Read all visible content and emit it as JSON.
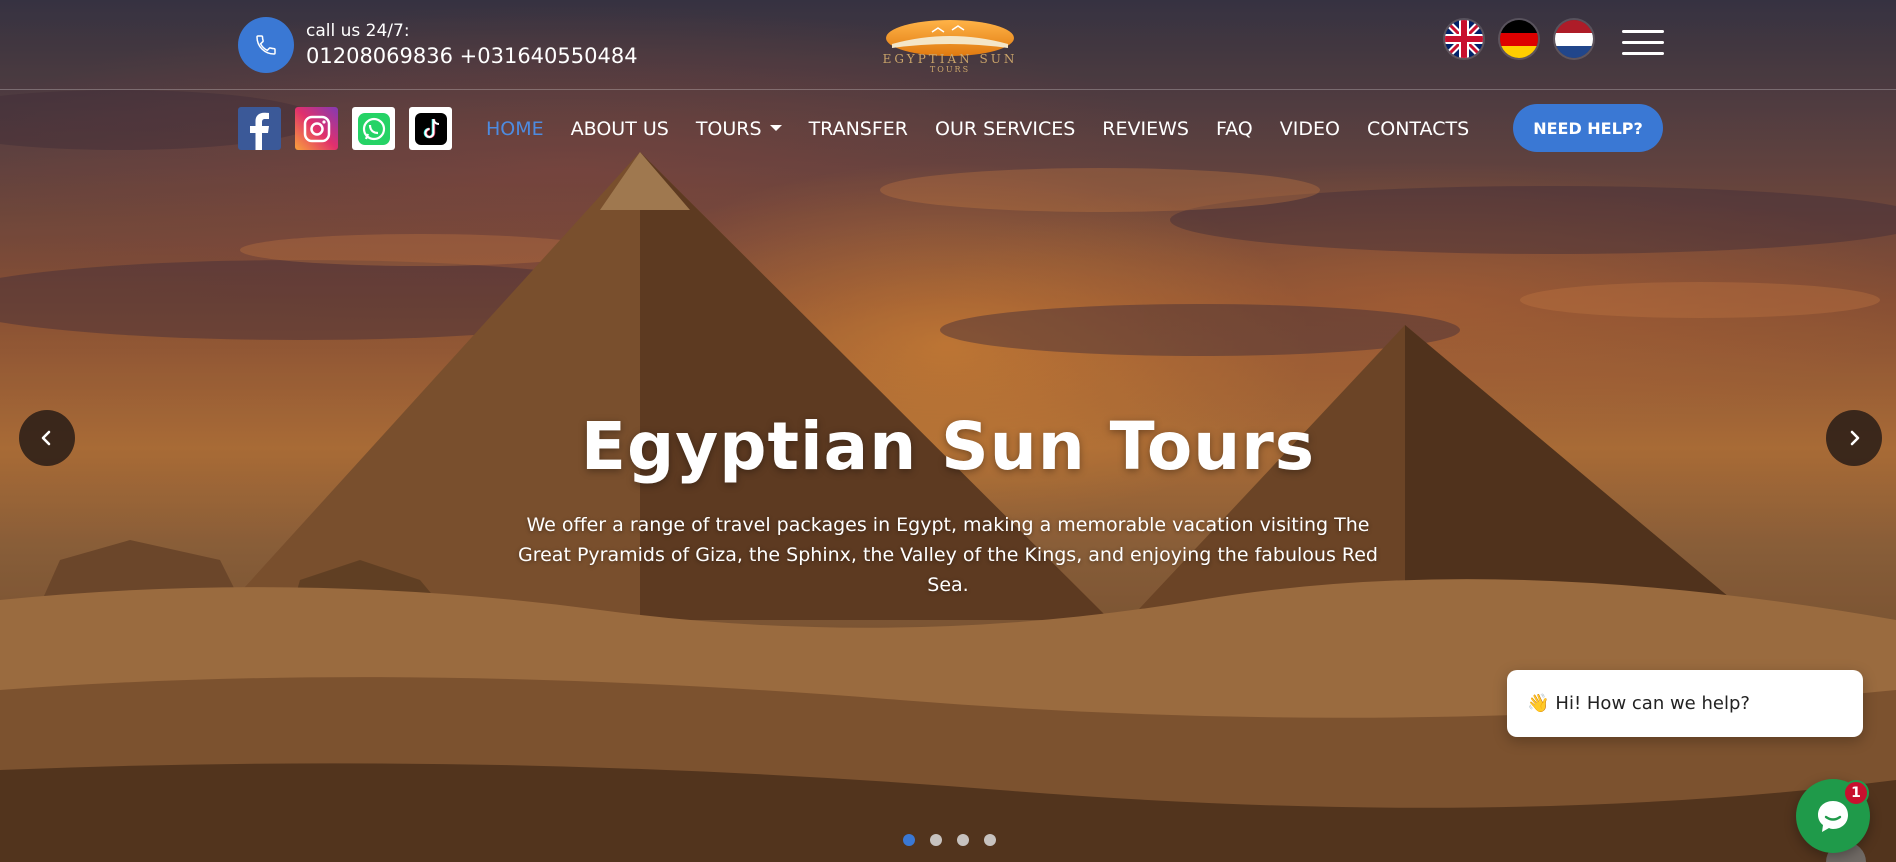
{
  "topbar": {
    "call_label": "call us 24/7:",
    "call_numbers": "01208069836 +031640550484",
    "logo_text": "EGYPTIAN SUN",
    "logo_sub": "TOURS",
    "languages": [
      "English",
      "Deutsch",
      "Nederlands"
    ]
  },
  "social": [
    "facebook",
    "instagram",
    "whatsapp",
    "tiktok"
  ],
  "nav": {
    "items": [
      {
        "label": "HOME",
        "active": true
      },
      {
        "label": "ABOUT US"
      },
      {
        "label": "TOURS",
        "dropdown": true
      },
      {
        "label": "TRANSFER"
      },
      {
        "label": "OUR SERVICES"
      },
      {
        "label": "REVIEWS"
      },
      {
        "label": "FAQ"
      },
      {
        "label": "VIDEO"
      },
      {
        "label": "CONTACTS"
      }
    ],
    "help_button": "NEED HELP?"
  },
  "hero": {
    "title": "Egyptian Sun Tours",
    "subtitle": "We offer a range of travel packages in Egypt, making a memorable vacation visiting The Great Pyramids of Giza, the Sphinx, the Valley of the Kings, and enjoying the fabulous Red Sea.",
    "slides": 4,
    "active_slide": 1
  },
  "chat": {
    "greeting_emoji": "👋",
    "greeting": "Hi! How can we help?",
    "badge_count": "1"
  },
  "colors": {
    "accent": "#3a78d4",
    "nav_active": "#4d8be0",
    "chat_green": "#1f9a4a",
    "badge_red": "#c8102e"
  }
}
